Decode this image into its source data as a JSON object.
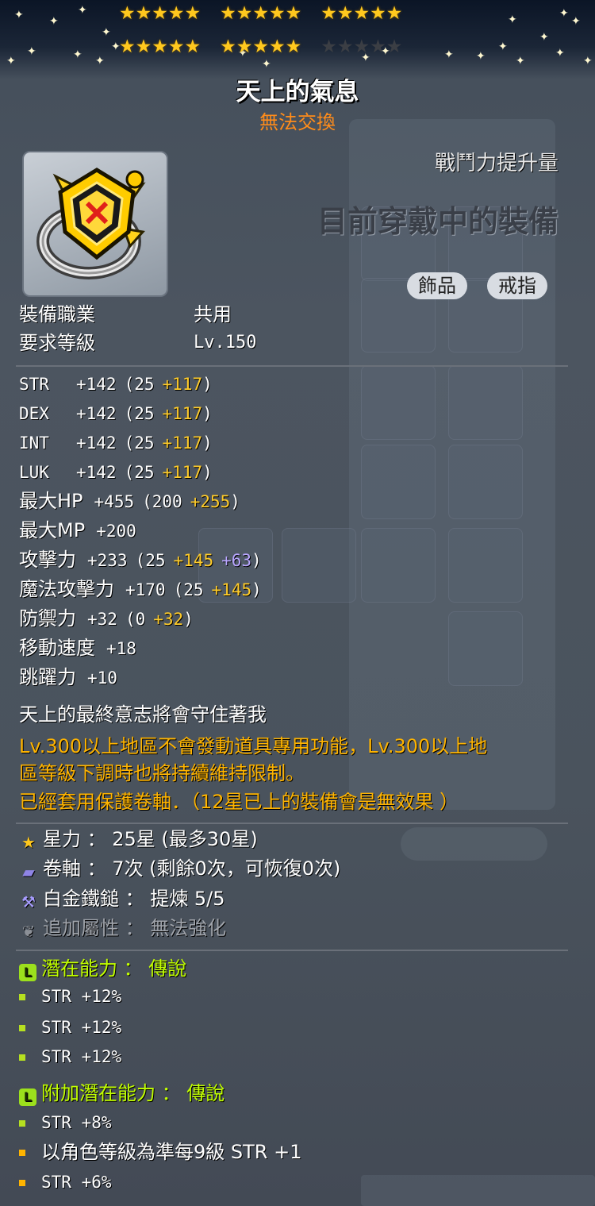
{
  "header": {
    "stars_filled": 25,
    "stars_total": 30,
    "item_name": "天上的氣息",
    "trade_status": "無法交換"
  },
  "panel": {
    "combat_power_label": "戰鬥力提升量",
    "equipped_label": "目前穿戴中的裝備",
    "categories": [
      "飾品",
      "戒指"
    ]
  },
  "requirements": [
    {
      "label": "裝備職業",
      "value": "共用"
    },
    {
      "label": "要求等級",
      "value": "Lv.150"
    }
  ],
  "stats": [
    {
      "label": "STR",
      "total": "+142",
      "open": "(",
      "base": "25",
      "bonus_yellow": "+117",
      "bonus_purple": "",
      "close": ")"
    },
    {
      "label": "DEX",
      "total": "+142",
      "open": "(",
      "base": "25",
      "bonus_yellow": "+117",
      "bonus_purple": "",
      "close": ")"
    },
    {
      "label": "INT",
      "total": "+142",
      "open": "(",
      "base": "25",
      "bonus_yellow": "+117",
      "bonus_purple": "",
      "close": ")"
    },
    {
      "label": "LUK",
      "total": "+142",
      "open": "(",
      "base": "25",
      "bonus_yellow": "+117",
      "bonus_purple": "",
      "close": ")"
    },
    {
      "label": "最大HP",
      "total": "+455",
      "open": "(",
      "base": "200",
      "bonus_yellow": "+255",
      "bonus_purple": "",
      "close": ")"
    },
    {
      "label": "最大MP",
      "total": "+200",
      "open": "",
      "base": "",
      "bonus_yellow": "",
      "bonus_purple": "",
      "close": ""
    },
    {
      "label": "攻擊力",
      "total": "+233",
      "open": "(",
      "base": "25",
      "bonus_yellow": "+145",
      "bonus_purple": "+63",
      "close": ")"
    },
    {
      "label": "魔法攻擊力",
      "total": "+170",
      "open": "(",
      "base": "25",
      "bonus_yellow": "+145",
      "bonus_purple": "",
      "close": ")"
    },
    {
      "label": "防禦力",
      "total": "+32",
      "open": "(",
      "base": "0",
      "bonus_yellow": "+32",
      "bonus_purple": "",
      "close": ")"
    },
    {
      "label": "移動速度",
      "total": "+18",
      "open": "",
      "base": "",
      "bonus_yellow": "",
      "bonus_purple": "",
      "close": ""
    },
    {
      "label": "跳躍力",
      "total": "+10",
      "open": "",
      "base": "",
      "bonus_yellow": "",
      "bonus_purple": "",
      "close": ""
    }
  ],
  "description": {
    "flavor": "天上的最終意志將會守住著我",
    "restriction_line1": "Lv.300以上地區不會發動道具專用功能，Lv.300以上地",
    "restriction_line2": "區等級下調時也將持續維持限制。",
    "protection": "已經套用保護卷軸．（12星已上的裝備會是無效果 ）"
  },
  "enhancements": [
    {
      "icon": "star-icon",
      "label": "星力 ： 25星 (最多30星)",
      "color": "#ffffff"
    },
    {
      "icon": "scroll-icon",
      "label": "卷軸 ： 7次 (剩餘0次，可恢復0次)",
      "color": "#ffffff"
    },
    {
      "icon": "hammer-icon",
      "label": "白金鐵鎚 ： 提煉 5/5",
      "color": "#ffffff"
    },
    {
      "icon": "leaf-icon",
      "label": "追加屬性 ： 無法強化",
      "color": "#a0a4ab"
    }
  ],
  "potential": {
    "title": "潛在能力 ： 傳說",
    "lines": [
      "STR +12%",
      "STR +12%",
      "STR +12%"
    ]
  },
  "additional_potential": {
    "title": "附加潛在能力 ： 傳說",
    "lines": [
      {
        "text": "STR +8%",
        "bullet": "green"
      },
      {
        "text": "以角色等級為準每9級 STR +1",
        "bullet": "orange"
      },
      {
        "text": "STR +6%",
        "bullet": "orange"
      }
    ]
  },
  "colors": {
    "star_filled": "#ffc81e",
    "bonus_yellow": "#ffcc2a",
    "bonus_purple": "#b9a6ff",
    "orange_text": "#ffb400",
    "potential_green": "#c2ff00",
    "untradable": "#ff8c1a"
  }
}
